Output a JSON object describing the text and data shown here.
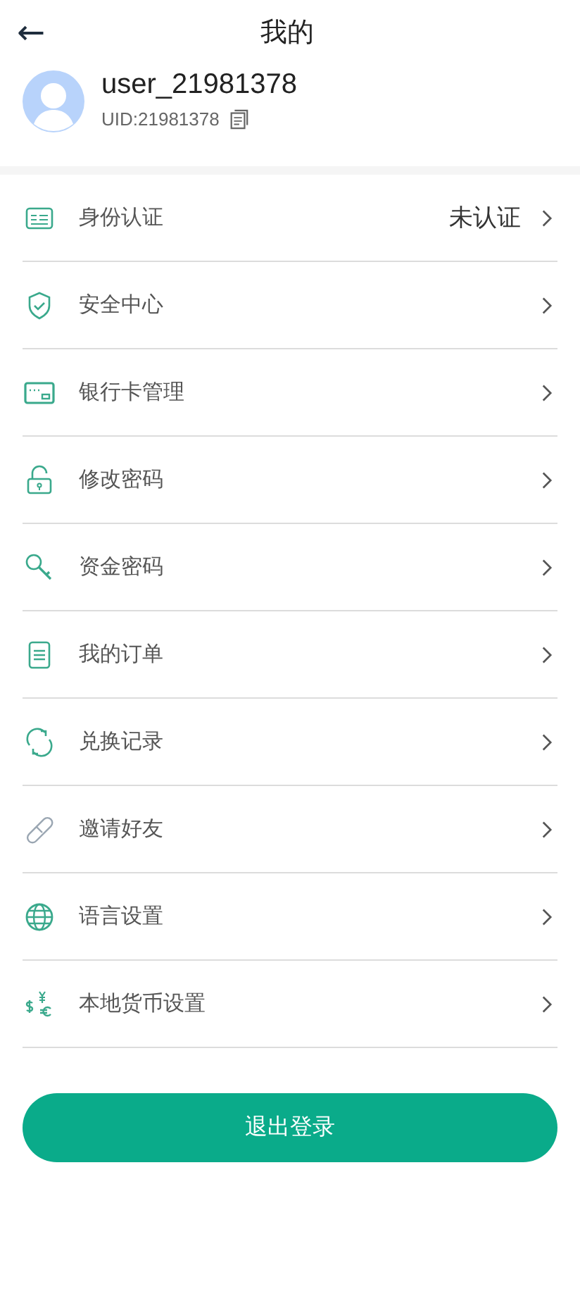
{
  "header": {
    "back": "←",
    "title": "我的"
  },
  "profile": {
    "username": "user_21981378",
    "uid": "UID:21981378"
  },
  "menu": [
    {
      "kind": "id-card",
      "label": "身份认证",
      "value": "未认证"
    },
    {
      "kind": "shield",
      "label": "安全中心"
    },
    {
      "kind": "card",
      "label": "银行卡管理"
    },
    {
      "kind": "lock",
      "label": "修改密码"
    },
    {
      "kind": "key",
      "label": "资金密码"
    },
    {
      "kind": "list",
      "label": "我的订单"
    },
    {
      "kind": "refresh",
      "label": "兑换记录"
    },
    {
      "kind": "link",
      "label": "邀请好友"
    },
    {
      "kind": "globe",
      "label": "语言设置"
    },
    {
      "kind": "currency",
      "label": "本地货币设置"
    }
  ],
  "logout": "退出登录"
}
